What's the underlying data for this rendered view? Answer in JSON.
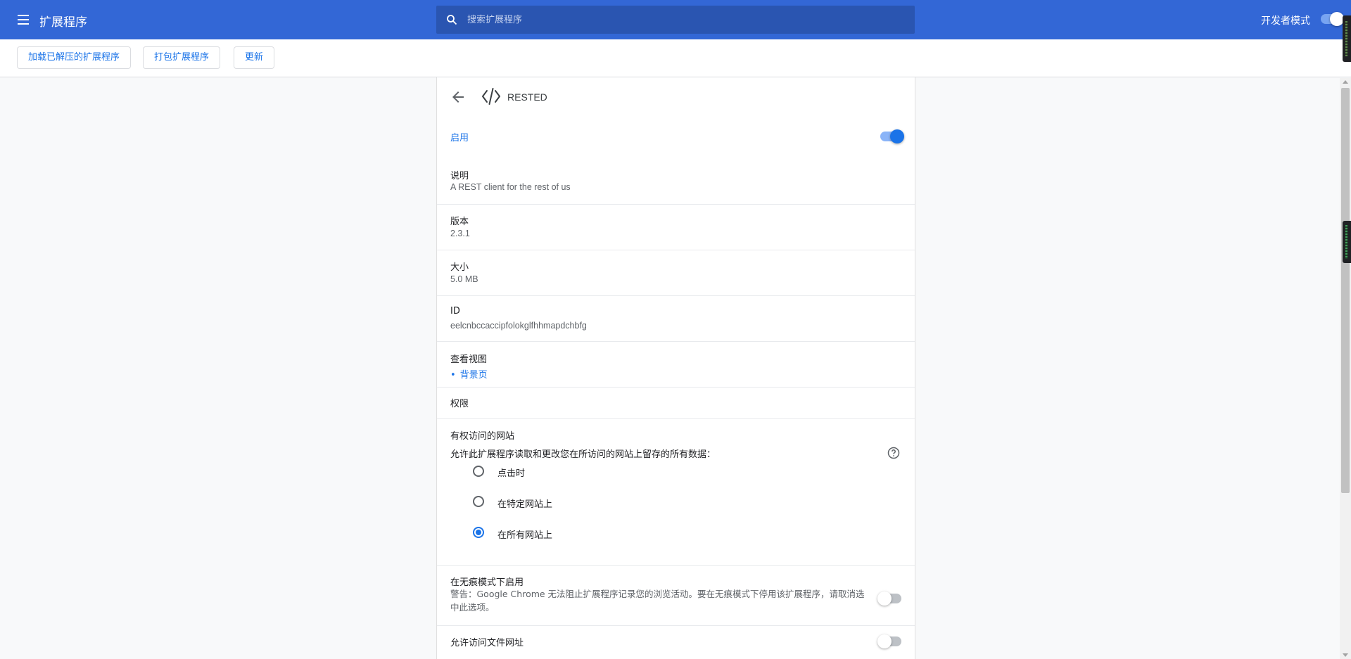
{
  "header": {
    "title": "扩展程序",
    "search_placeholder": "搜索扩展程序",
    "dev_mode_label": "开发者模式",
    "dev_mode_on": true
  },
  "toolbar": {
    "load_unpacked": "加载已解压的扩展程序",
    "pack": "打包扩展程序",
    "update": "更新"
  },
  "extension": {
    "name": "RESTED",
    "enabled_label": "启用",
    "enabled": true,
    "description_label": "说明",
    "description": "A REST client for the rest of us",
    "version_label": "版本",
    "version": "2.3.1",
    "size_label": "大小",
    "size": "5.0 MB",
    "id_label": "ID",
    "id": "eelcnbccaccipfolokglfhhmapdchbfg",
    "views_label": "查看视图",
    "views": [
      "背景页"
    ],
    "permissions_label": "权限",
    "site_access": {
      "title": "有权访问的网站",
      "prompt": "允许此扩展程序读取和更改您在所访问的网站上留存的所有数据：",
      "options": [
        "点击时",
        "在特定网站上",
        "在所有网站上"
      ],
      "selected": "在所有网站上"
    },
    "incognito": {
      "label": "在无痕模式下启用",
      "warning": "警告：Google Chrome 无法阻止扩展程序记录您的浏览活动。要在无痕模式下停用该扩展程序，请取消选中此选项。",
      "enabled": false
    },
    "file_urls": {
      "label": "允许访问文件网址",
      "enabled": false
    }
  },
  "colors": {
    "header_bg": "#3367d6",
    "accent": "#1a73e8"
  }
}
